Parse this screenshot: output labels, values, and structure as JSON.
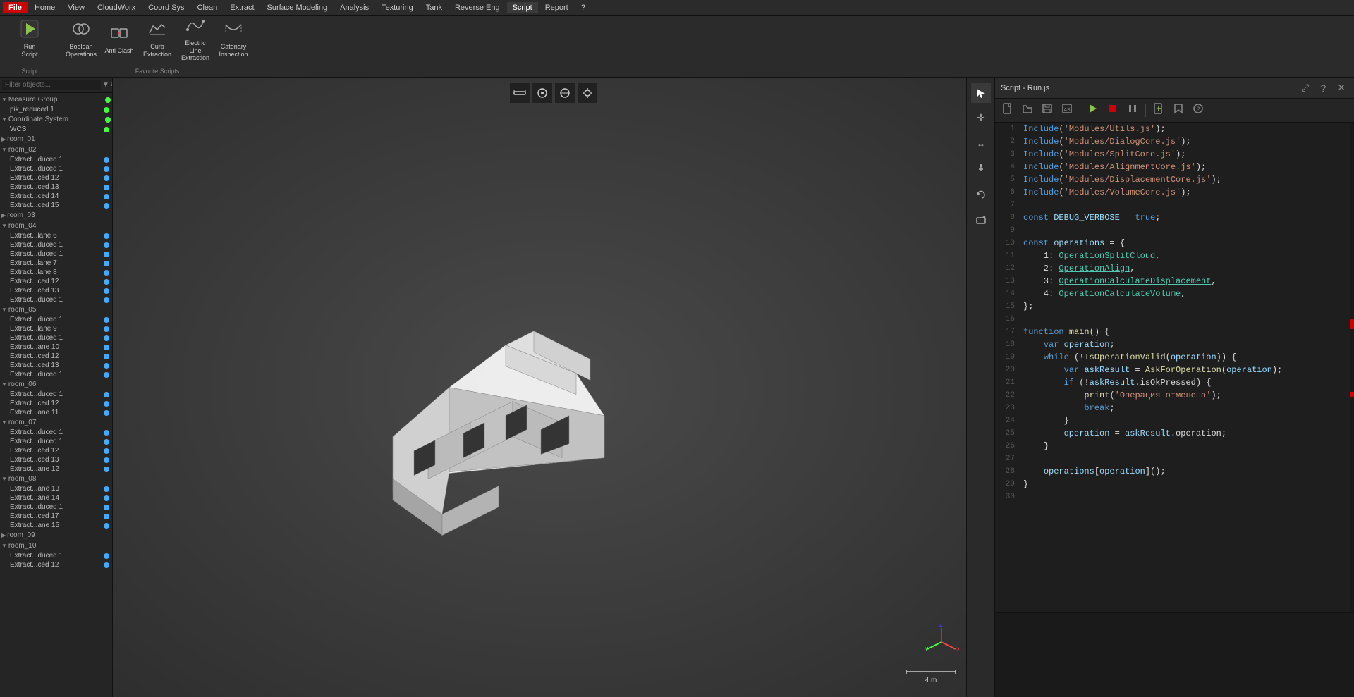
{
  "menubar": {
    "file_label": "File",
    "items": [
      "Home",
      "View",
      "CloudWorx",
      "Coord Sys",
      "Clean",
      "Extract",
      "Surface Modeling",
      "Analysis",
      "Texturing",
      "Tank",
      "Reverse Eng",
      "Script",
      "Report",
      "?"
    ]
  },
  "toolbar": {
    "groups": [
      {
        "label": "Script",
        "buttons": [
          {
            "icon": "▶",
            "label": "Run\nScript"
          }
        ]
      },
      {
        "label": "Favorite Scripts",
        "buttons": [
          {
            "icon": "⊕",
            "label": "Boolean\nOperations"
          },
          {
            "icon": "⚡",
            "label": "Anti Clash"
          },
          {
            "icon": "⊞",
            "label": "Curb\nExtraction"
          },
          {
            "icon": "〰",
            "label": "Electric Line\nExtraction"
          },
          {
            "icon": "⌒",
            "label": "Catenary\nInspection"
          }
        ]
      }
    ]
  },
  "tree": {
    "filter_placeholder": "Filter objects...",
    "groups": [
      {
        "label": "Measure Group",
        "expanded": true,
        "items": [
          {
            "name": "pik_reduced 1",
            "dot": "green",
            "indent": 1
          }
        ]
      },
      {
        "label": "Coordinate System",
        "expanded": true,
        "items": [
          {
            "name": "WCS",
            "dot": "green",
            "indent": 1
          }
        ]
      },
      {
        "label": "room_01",
        "expanded": false,
        "items": []
      },
      {
        "label": "room_02",
        "expanded": true,
        "items": [
          {
            "name": "Extract...duced 1",
            "dot": "blue"
          },
          {
            "name": "Extract...duced 1",
            "dot": "blue"
          },
          {
            "name": "Extract...ced 12",
            "dot": "blue"
          },
          {
            "name": "Extract...ced 13",
            "dot": "blue"
          },
          {
            "name": "Extract...ced 14",
            "dot": "blue"
          },
          {
            "name": "Extract...ced 15",
            "dot": "blue"
          }
        ]
      },
      {
        "label": "room_03",
        "expanded": false,
        "items": []
      },
      {
        "label": "room_04",
        "expanded": true,
        "items": [
          {
            "name": "Extract...lane 6",
            "dot": "blue"
          },
          {
            "name": "Extract...duced 1",
            "dot": "blue"
          },
          {
            "name": "Extract...duced 1",
            "dot": "blue"
          },
          {
            "name": "Extract...lane 7",
            "dot": "blue"
          },
          {
            "name": "Extract...lane 8",
            "dot": "blue"
          },
          {
            "name": "Extract...ced 12",
            "dot": "blue"
          },
          {
            "name": "Extract...ced 13",
            "dot": "blue"
          },
          {
            "name": "Extract...duced 1",
            "dot": "blue"
          }
        ]
      },
      {
        "label": "room_05",
        "expanded": true,
        "items": [
          {
            "name": "Extract...duced 1",
            "dot": "blue"
          },
          {
            "name": "Extract...lane 9",
            "dot": "blue"
          },
          {
            "name": "Extract...duced 1",
            "dot": "blue"
          },
          {
            "name": "Extract...ane 10",
            "dot": "blue"
          },
          {
            "name": "Extract...ced 12",
            "dot": "blue"
          },
          {
            "name": "Extract...ced 13",
            "dot": "blue"
          },
          {
            "name": "Extract...duced 1",
            "dot": "blue"
          }
        ]
      },
      {
        "label": "room_06",
        "expanded": true,
        "items": [
          {
            "name": "Extract...duced 1",
            "dot": "blue"
          },
          {
            "name": "Extract...ced 12",
            "dot": "blue"
          },
          {
            "name": "Extract...ane 11",
            "dot": "blue"
          }
        ]
      },
      {
        "label": "room_07",
        "expanded": true,
        "items": [
          {
            "name": "Extract...duced 1",
            "dot": "blue"
          },
          {
            "name": "Extract...duced 1",
            "dot": "blue"
          },
          {
            "name": "Extract...ced 12",
            "dot": "blue"
          },
          {
            "name": "Extract...ced 13",
            "dot": "blue"
          },
          {
            "name": "Extract...ane 12",
            "dot": "blue"
          }
        ]
      },
      {
        "label": "room_08",
        "expanded": true,
        "items": [
          {
            "name": "Extract...ane 13",
            "dot": "blue"
          },
          {
            "name": "Extract...ane 14",
            "dot": "blue"
          },
          {
            "name": "Extract...duced 1",
            "dot": "blue"
          },
          {
            "name": "Extract...ced 17",
            "dot": "blue"
          },
          {
            "name": "Extract...ane 15",
            "dot": "blue"
          }
        ]
      },
      {
        "label": "room_09",
        "expanded": false,
        "items": []
      },
      {
        "label": "room_10",
        "expanded": true,
        "items": [
          {
            "name": "Extract...duced 1",
            "dot": "blue"
          },
          {
            "name": "Extract...ced 12",
            "dot": "blue"
          }
        ]
      }
    ]
  },
  "viewport": {
    "scale_label": "4 m"
  },
  "script_panel": {
    "title": "Script - Run.js",
    "code_lines": [
      {
        "num": 1,
        "text": "Include('Modules/Utils.js');"
      },
      {
        "num": 2,
        "text": "Include('Modules/DialogCore.js');"
      },
      {
        "num": 3,
        "text": "Include('Modules/SplitCore.js');"
      },
      {
        "num": 4,
        "text": "Include('Modules/AlignmentCore.js');"
      },
      {
        "num": 5,
        "text": "Include('Modules/DisplacementCore.js');"
      },
      {
        "num": 6,
        "text": "Include('Modules/VolumeCore.js');"
      },
      {
        "num": 7,
        "text": ""
      },
      {
        "num": 8,
        "text": "const DEBUG_VERBOSE = true;"
      },
      {
        "num": 9,
        "text": ""
      },
      {
        "num": 10,
        "text": "const operations = {"
      },
      {
        "num": 11,
        "text": "    1: OperationSplitCloud,"
      },
      {
        "num": 12,
        "text": "    2: OperationAlign,"
      },
      {
        "num": 13,
        "text": "    3: OperationCalculateDisplacement,"
      },
      {
        "num": 14,
        "text": "    4: OperationCalculateVolume,"
      },
      {
        "num": 15,
        "text": "};"
      },
      {
        "num": 16,
        "text": ""
      },
      {
        "num": 17,
        "text": "function main() {"
      },
      {
        "num": 18,
        "text": "    var operation;"
      },
      {
        "num": 19,
        "text": "    while (!IsOperationValid(operation)) {"
      },
      {
        "num": 20,
        "text": "        var askResult = AskForOperation(operation);"
      },
      {
        "num": 21,
        "text": "        if (!askResult.isOkPressed) {"
      },
      {
        "num": 22,
        "text": "            print('Операция отменена');"
      },
      {
        "num": 23,
        "text": "            break;"
      },
      {
        "num": 24,
        "text": "        }"
      },
      {
        "num": 25,
        "text": "        operation = askResult.operation;"
      },
      {
        "num": 26,
        "text": "    }"
      },
      {
        "num": 27,
        "text": ""
      },
      {
        "num": 28,
        "text": "    operations[operation]();"
      },
      {
        "num": 29,
        "text": "}"
      },
      {
        "num": 30,
        "text": ""
      }
    ]
  }
}
